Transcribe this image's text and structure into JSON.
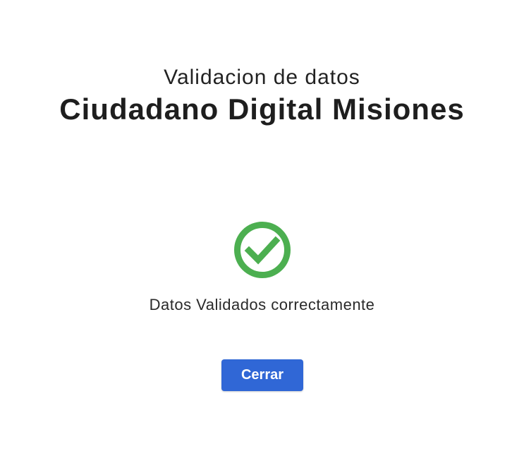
{
  "dialog": {
    "subtitle": "Validacion de datos",
    "title": "Ciudadano Digital Misiones",
    "status_icon": "check-circle-icon",
    "message": "Datos Validados correctamente",
    "close_label": "Cerrar"
  },
  "colors": {
    "success": "#4caf50",
    "primary_button": "#3067d6",
    "background": "#ffffff"
  }
}
